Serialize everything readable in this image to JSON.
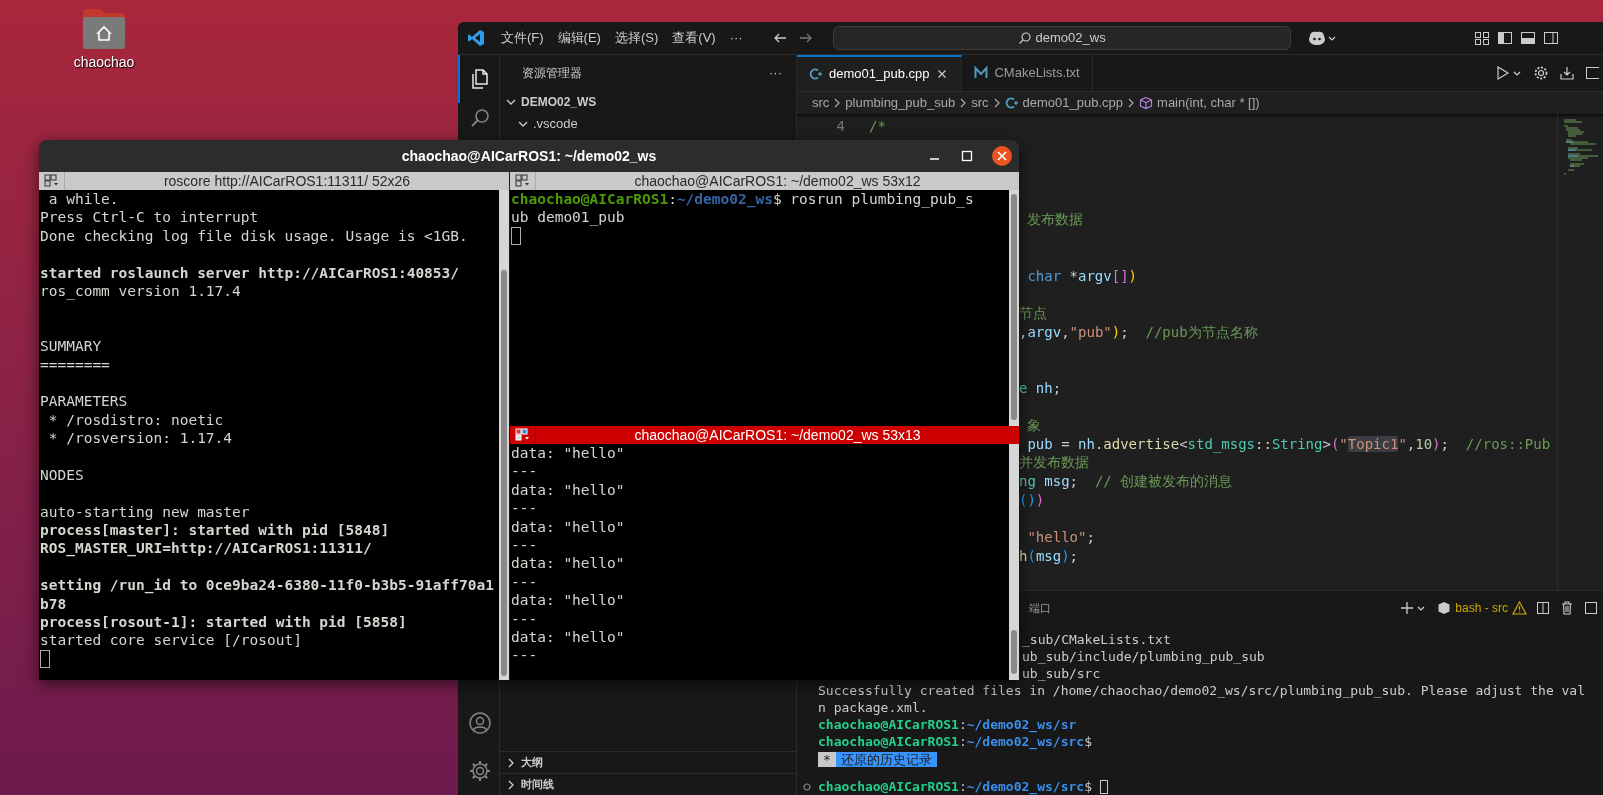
{
  "desktop": {
    "icons": [
      {
        "label": "chaochao"
      }
    ]
  },
  "vscode": {
    "menu": [
      "文件(F)",
      "编辑(E)",
      "选择(S)",
      "查看(V)",
      "···"
    ],
    "search": {
      "value": "demo02_ws"
    },
    "activity_top": [
      {
        "kind": "explorer",
        "selected": true
      },
      {
        "kind": "search",
        "selected": false
      }
    ],
    "activity_bottom": [
      {
        "kind": "account",
        "selected": false
      },
      {
        "kind": "settings",
        "selected": false
      }
    ],
    "explorer": {
      "title": "资源管理器",
      "more": "···",
      "tree": [
        {
          "label": "DEMO02_WS",
          "expanded": true,
          "children": [
            {
              "label": ".vscode",
              "expanded": true
            }
          ]
        }
      ],
      "sections": [
        {
          "label": "大纲",
          "expanded": false
        },
        {
          "label": "时间线",
          "expanded": false
        }
      ]
    },
    "tabs": [
      {
        "label": "demo01_pub.cpp",
        "kind": "cpp",
        "selected": true
      },
      {
        "label": "CMakeLists.txt",
        "kind": "cmake",
        "selected": false
      }
    ],
    "breadcrumb": [
      {
        "label": "src",
        "kind": "folder"
      },
      {
        "label": "plumbing_pub_sub",
        "kind": "folder"
      },
      {
        "label": "src",
        "kind": "folder"
      },
      {
        "label": "demo01_pub.cpp",
        "kind": "cpp"
      },
      {
        "label": "main(int, char * [])",
        "kind": "symbol"
      }
    ],
    "code_lines": [
      {
        "kind": "numbered",
        "number": "4",
        "tokens": [
          {
            "text": "/*",
            "kind": "comment"
          }
        ]
      },
      {
        "kind": "hidden"
      },
      {
        "kind": "hidden"
      },
      {
        "kind": "hidden"
      },
      {
        "kind": "hidden"
      },
      {
        "kind": "fragment",
        "tokens": [
          {
            "text": " 发布数据",
            "kind": "comment"
          }
        ]
      },
      {
        "kind": "hidden"
      },
      {
        "kind": "hidden"
      },
      {
        "kind": "fragment",
        "tokens": [
          {
            "text": " char",
            "kind": "keyword"
          },
          {
            "text": " *",
            "kind": "plain"
          },
          {
            "text": "argv",
            "kind": "variable"
          },
          {
            "text": "[]",
            "kind": "bracket-purple"
          },
          {
            "text": ")",
            "kind": "bracket-gold"
          }
        ]
      },
      {
        "kind": "hidden"
      },
      {
        "kind": "fragment",
        "tokens": [
          {
            "text": "节点",
            "kind": "comment"
          }
        ]
      },
      {
        "kind": "fragment",
        "tokens": [
          {
            "text": ",",
            "kind": "plain"
          },
          {
            "text": "argv",
            "kind": "variable"
          },
          {
            "text": ",",
            "kind": "plain"
          },
          {
            "text": "\"pub\"",
            "kind": "string"
          },
          {
            "text": ")",
            "kind": "bracket-gold"
          },
          {
            "text": ";  ",
            "kind": "plain"
          },
          {
            "text": "//pub为节点名称",
            "kind": "comment"
          }
        ]
      },
      {
        "kind": "hidden"
      },
      {
        "kind": "hidden"
      },
      {
        "kind": "fragment",
        "tokens": [
          {
            "text": "e",
            "kind": "type"
          },
          {
            "text": " nh",
            "kind": "variable"
          },
          {
            "text": ";",
            "kind": "plain"
          }
        ]
      },
      {
        "kind": "hidden"
      },
      {
        "kind": "fragment",
        "tokens": [
          {
            "text": " 象",
            "kind": "comment"
          }
        ]
      },
      {
        "kind": "fragment",
        "tokens": [
          {
            "text": " pub",
            "kind": "variable"
          },
          {
            "text": " = ",
            "kind": "plain"
          },
          {
            "text": "nh",
            "kind": "variable"
          },
          {
            "text": ".",
            "kind": "plain"
          },
          {
            "text": "advertise",
            "kind": "function"
          },
          {
            "text": "<",
            "kind": "plain"
          },
          {
            "text": "std_msgs",
            "kind": "type"
          },
          {
            "text": "::",
            "kind": "plain"
          },
          {
            "text": "String",
            "kind": "type"
          },
          {
            "text": ">",
            "kind": "plain"
          },
          {
            "text": "(",
            "kind": "bracket-purple"
          },
          {
            "text": "\"",
            "kind": "string"
          },
          {
            "text": "Topic1",
            "kind": "match"
          },
          {
            "text": "\"",
            "kind": "string"
          },
          {
            "text": ",",
            "kind": "plain"
          },
          {
            "text": "10",
            "kind": "number"
          },
          {
            "text": ")",
            "kind": "bracket-purple"
          },
          {
            "text": ";  ",
            "kind": "plain"
          },
          {
            "text": "//ros::Pub",
            "kind": "comment"
          }
        ]
      },
      {
        "kind": "fragment",
        "tokens": [
          {
            "text": "并发布数据",
            "kind": "comment"
          }
        ]
      },
      {
        "kind": "fragment",
        "tokens": [
          {
            "text": "ng",
            "kind": "type"
          },
          {
            "text": " msg",
            "kind": "variable"
          },
          {
            "text": ";  ",
            "kind": "plain"
          },
          {
            "text": "// 创建被发布的消息",
            "kind": "comment"
          }
        ]
      },
      {
        "kind": "fragment",
        "tokens": [
          {
            "text": "()",
            "kind": "bracket-blue"
          },
          {
            "text": ")",
            "kind": "bracket-purple"
          }
        ]
      },
      {
        "kind": "hidden"
      },
      {
        "kind": "fragment",
        "tokens": [
          {
            "text": " \"hello\"",
            "kind": "string"
          },
          {
            "text": ";",
            "kind": "plain"
          }
        ]
      },
      {
        "kind": "fragment",
        "tokens": [
          {
            "text": "h",
            "kind": "function"
          },
          {
            "text": "(",
            "kind": "bracket-blue"
          },
          {
            "text": "msg",
            "kind": "variable"
          },
          {
            "text": ")",
            "kind": "bracket-blue"
          },
          {
            "text": ";",
            "kind": "plain"
          }
        ]
      }
    ],
    "panel": {
      "tabs": [
        {
          "label": "端口",
          "selected": false
        }
      ],
      "terminal_label": "bash - src",
      "lines": [
        {
          "kind": "fragment",
          "segments": [
            {
              "text": "_sub/CMakeLists.txt",
              "kind": "plain"
            }
          ]
        },
        {
          "kind": "fragment",
          "segments": [
            {
              "text": "ub_sub/include/plumbing_pub_sub",
              "kind": "plain"
            }
          ]
        },
        {
          "kind": "fragment",
          "segments": [
            {
              "text": "ub_sub/src",
              "kind": "plain"
            }
          ]
        },
        {
          "kind": "text",
          "segments": [
            {
              "text": "Successfully created files in /home/chaochao/demo02_ws/src/plumbing_pub_sub. Please adjust the val",
              "kind": "plain"
            }
          ]
        },
        {
          "kind": "text",
          "segments": [
            {
              "text": "n package.xml.",
              "kind": "plain"
            }
          ]
        },
        {
          "kind": "text",
          "segments": [
            {
              "text": "chaochao@AICarROS1",
              "kind": "user"
            },
            {
              "text": ":",
              "kind": "plain"
            },
            {
              "text": "~/demo02_ws/sr",
              "kind": "path"
            }
          ]
        },
        {
          "kind": "text",
          "segments": [
            {
              "text": "chaochao@AICarROS1",
              "kind": "user"
            },
            {
              "text": ":",
              "kind": "plain"
            },
            {
              "text": "~/demo02_ws/src",
              "kind": "path"
            },
            {
              "text": "$",
              "kind": "plain"
            }
          ]
        },
        {
          "kind": "hint",
          "segments": [
            {
              "text": "*",
              "kind": "marker"
            },
            {
              "text": "还原的历史记录",
              "kind": "history"
            }
          ]
        },
        {
          "kind": "blank"
        },
        {
          "kind": "text",
          "decorated": true,
          "segments": [
            {
              "text": "chaochao@AICarROS1",
              "kind": "user"
            },
            {
              "text": ":",
              "kind": "plain"
            },
            {
              "text": "~/demo02_ws/src",
              "kind": "path"
            },
            {
              "text": "$",
              "kind": "plain"
            },
            {
              "kind": "cursor"
            }
          ]
        }
      ]
    }
  },
  "terminator": {
    "title": "chaochao@AICarROS1: ~/demo02_ws",
    "panes": [
      {
        "header": "roscore http://AICarROS1:11311/ 52x26",
        "active": false,
        "lines": [
          {
            "kind": "text",
            "segments": [
              {
                "text": " a while.",
                "kind": "plain"
              }
            ]
          },
          {
            "kind": "text",
            "segments": [
              {
                "text": "Press Ctrl-C to interrupt",
                "kind": "plain"
              }
            ]
          },
          {
            "kind": "text",
            "segments": [
              {
                "text": "Done checking log file disk usage. Usage is <1GB.",
                "kind": "plain"
              }
            ]
          },
          {
            "kind": "blank"
          },
          {
            "kind": "text",
            "segments": [
              {
                "text": "started roslaunch server http://AICarROS1:40853/",
                "kind": "bold"
              }
            ]
          },
          {
            "kind": "text",
            "segments": [
              {
                "text": "ros_comm version 1.17.4",
                "kind": "plain"
              }
            ]
          },
          {
            "kind": "blank"
          },
          {
            "kind": "blank"
          },
          {
            "kind": "text",
            "segments": [
              {
                "text": "SUMMARY",
                "kind": "plain"
              }
            ]
          },
          {
            "kind": "text",
            "segments": [
              {
                "text": "========",
                "kind": "plain"
              }
            ]
          },
          {
            "kind": "blank"
          },
          {
            "kind": "text",
            "segments": [
              {
                "text": "PARAMETERS",
                "kind": "plain"
              }
            ]
          },
          {
            "kind": "text",
            "segments": [
              {
                "text": " * /rosdistro: noetic",
                "kind": "plain"
              }
            ]
          },
          {
            "kind": "text",
            "segments": [
              {
                "text": " * /rosversion: 1.17.4",
                "kind": "plain"
              }
            ]
          },
          {
            "kind": "blank"
          },
          {
            "kind": "text",
            "segments": [
              {
                "text": "NODES",
                "kind": "plain"
              }
            ]
          },
          {
            "kind": "blank"
          },
          {
            "kind": "text",
            "segments": [
              {
                "text": "auto-starting new master",
                "kind": "plain"
              }
            ]
          },
          {
            "kind": "text",
            "segments": [
              {
                "text": "process[master]: started with pid [5848]",
                "kind": "bold"
              }
            ]
          },
          {
            "kind": "text",
            "segments": [
              {
                "text": "ROS_MASTER_URI=http://AICarROS1:11311/",
                "kind": "bold"
              }
            ]
          },
          {
            "kind": "blank"
          },
          {
            "kind": "text",
            "segments": [
              {
                "text": "setting /run_id to 0ce9ba24-6380-11f0-b3b5-91aff70a1",
                "kind": "bold"
              }
            ]
          },
          {
            "kind": "text",
            "segments": [
              {
                "text": "b78",
                "kind": "bold"
              }
            ]
          },
          {
            "kind": "text",
            "segments": [
              {
                "text": "process[rosout-1]: started with pid [5858]",
                "kind": "bold"
              }
            ]
          },
          {
            "kind": "text",
            "segments": [
              {
                "text": "started core service [/rosout]",
                "kind": "plain"
              }
            ]
          },
          {
            "kind": "cursor"
          }
        ]
      },
      {
        "header": "chaochao@AICarROS1: ~/demo02_ws 53x12",
        "active": false,
        "lines": [
          {
            "kind": "text",
            "segments": [
              {
                "text": "chaochao@AICarROS1",
                "kind": "user"
              },
              {
                "text": ":",
                "kind": "plain"
              },
              {
                "text": "~/demo02_ws",
                "kind": "path"
              },
              {
                "text": "$ rosrun plumbing_pub_s",
                "kind": "plain"
              }
            ]
          },
          {
            "kind": "text",
            "segments": [
              {
                "text": "ub demo01_pub",
                "kind": "plain"
              }
            ]
          },
          {
            "kind": "cursor"
          }
        ]
      },
      {
        "header": "chaochao@AICarROS1: ~/demo02_ws 53x13",
        "active": true,
        "lines": [
          {
            "kind": "text",
            "segments": [
              {
                "text": "data: \"hello\"",
                "kind": "plain"
              }
            ]
          },
          {
            "kind": "text",
            "segments": [
              {
                "text": "---",
                "kind": "plain"
              }
            ]
          },
          {
            "kind": "text",
            "segments": [
              {
                "text": "data: \"hello\"",
                "kind": "plain"
              }
            ]
          },
          {
            "kind": "text",
            "segments": [
              {
                "text": "---",
                "kind": "plain"
              }
            ]
          },
          {
            "kind": "text",
            "segments": [
              {
                "text": "data: \"hello\"",
                "kind": "plain"
              }
            ]
          },
          {
            "kind": "text",
            "segments": [
              {
                "text": "---",
                "kind": "plain"
              }
            ]
          },
          {
            "kind": "text",
            "segments": [
              {
                "text": "data: \"hello\"",
                "kind": "plain"
              }
            ]
          },
          {
            "kind": "text",
            "segments": [
              {
                "text": "---",
                "kind": "plain"
              }
            ]
          },
          {
            "kind": "text",
            "segments": [
              {
                "text": "data: \"hello\"",
                "kind": "plain"
              }
            ]
          },
          {
            "kind": "text",
            "segments": [
              {
                "text": "---",
                "kind": "plain"
              }
            ]
          },
          {
            "kind": "text",
            "segments": [
              {
                "text": "data: \"hello\"",
                "kind": "plain"
              }
            ]
          },
          {
            "kind": "text",
            "segments": [
              {
                "text": "---",
                "kind": "plain"
              }
            ]
          }
        ]
      }
    ]
  }
}
